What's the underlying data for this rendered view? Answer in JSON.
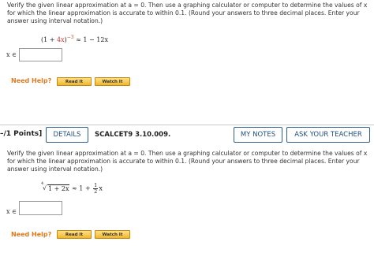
{
  "question1": {
    "text": "Verify the given linear approximation at a = 0. Then use a graphing calculator or computer to determine the values of x for which the linear approximation is accurate to within 0.1. (Round your answers to three decimal places. Enter your answer using interval notation.)",
    "formula_lhs_open": "(1 + ",
    "formula_lhs_red": "4x",
    "formula_lhs_close": ")",
    "formula_exp": "−3",
    "formula_rhs": "≈ 1 − 12x",
    "x_in_label": "x ∈",
    "answer_value": "",
    "need_help": "Need Help?",
    "read_it": "Read It",
    "watch_it": "Watch It"
  },
  "question2_header": {
    "points": "–/1 Points]",
    "details": "DETAILS",
    "code": "SCALCET9 3.10.009.",
    "my_notes": "MY NOTES",
    "ask_teacher": "ASK YOUR TEACHER"
  },
  "question2": {
    "text": "Verify the given linear approximation at a = 0. Then use a graphing calculator or computer to determine the values of x for which the linear approximation is accurate to within 0.1. (Round your answers to three decimal places. Enter your answer using interval notation.)",
    "root_index": "4",
    "root_radicand": "1 + 2x",
    "approx": "≈ 1 +",
    "frac_num": "1",
    "frac_den": "2",
    "frac_var": "x",
    "x_in_label": "x ∈",
    "answer_value": "",
    "need_help": "Need Help?",
    "read_it": "Read It",
    "watch_it": "Watch It"
  }
}
